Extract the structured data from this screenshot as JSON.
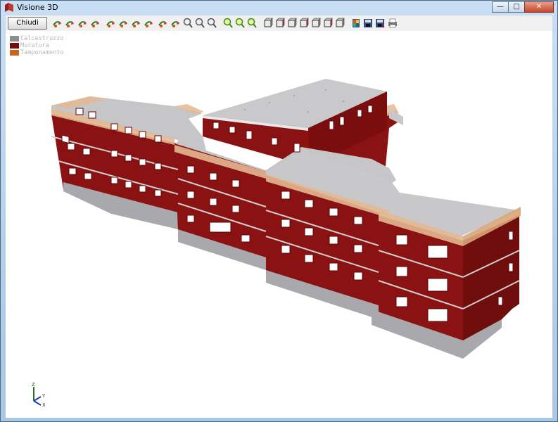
{
  "window": {
    "title": "Visione 3D",
    "minimize": "—",
    "maximize": "□",
    "close": "✕"
  },
  "toolbar": {
    "close_button": "Chiudi",
    "tool_icons": [
      "rotate-left-icon",
      "rotate-right-icon",
      "rotate-up-icon",
      "rotate-down-icon",
      "pan-left-icon",
      "pan-right-icon",
      "pan-up-icon",
      "pan-down-icon",
      "move-up-icon",
      "move-down-icon",
      "zoom-out-icon",
      "zoom-in-icon",
      "zoom-extents-icon",
      "zoom-window-icon",
      "zoom-plus-icon",
      "zoom-minus-icon",
      "view-front-icon",
      "view-back-icon",
      "view-left-icon",
      "view-right-icon",
      "view-top-icon",
      "view-bottom-icon",
      "view-iso-icon",
      "color-map-icon",
      "save-icon",
      "save-as-icon",
      "print-icon"
    ]
  },
  "legend": [
    {
      "label": "Calcestruzzo",
      "color": "#8c8c91"
    },
    {
      "label": "Muratura",
      "color": "#7a0c0c"
    },
    {
      "label": "Tamponamento",
      "color": "#c8641c"
    }
  ],
  "axes": {
    "z": "Z",
    "y": "Y",
    "x": "X"
  },
  "colors": {
    "wall": "#8b1212",
    "wall_dark": "#6e0c0c",
    "roof": "#c8c8cb",
    "parapet": "#e3b892",
    "concrete": "#a9a9ad"
  }
}
